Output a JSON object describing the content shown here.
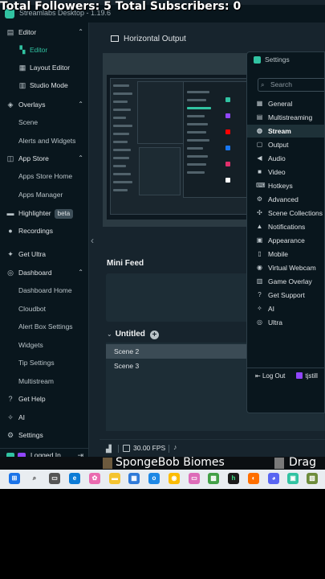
{
  "overlay": {
    "text": "Total Followers: 5  Total Subscribers: 0"
  },
  "window": {
    "title": "Streamlabs Desktop - 1.19.6"
  },
  "sidebar": {
    "items": [
      {
        "label": "Editor",
        "icon": "editor-icon",
        "chevron": "^"
      },
      {
        "label": "Editor",
        "icon": "editor-icon",
        "active": true
      },
      {
        "label": "Layout Editor",
        "icon": "layout-icon"
      },
      {
        "label": "Studio Mode",
        "icon": "studio-mode-icon"
      },
      {
        "label": "Overlays",
        "icon": "overlays-icon",
        "chevron": "^"
      },
      {
        "label": "Scene"
      },
      {
        "label": "Alerts and Widgets"
      },
      {
        "label": "App Store",
        "icon": "app-store-icon",
        "chevron": "^"
      },
      {
        "label": "Apps Store Home"
      },
      {
        "label": "Apps Manager"
      },
      {
        "label": "Highlighter",
        "icon": "highlighter-icon",
        "badge": "beta"
      },
      {
        "label": "Recordings",
        "icon": "recordings-icon"
      },
      {
        "label": "Get Ultra",
        "icon": "ultra-icon"
      },
      {
        "label": "Dashboard",
        "icon": "dashboard-icon",
        "chevron": "^"
      },
      {
        "label": "Dashboard Home"
      },
      {
        "label": "Cloudbot"
      },
      {
        "label": "Alert Box Settings"
      },
      {
        "label": "Widgets"
      },
      {
        "label": "Tip Settings"
      },
      {
        "label": "Multistream"
      },
      {
        "label": "Get Help",
        "icon": "help-icon"
      },
      {
        "label": "AI",
        "icon": "ai-icon"
      },
      {
        "label": "Settings",
        "icon": "gear-icon"
      }
    ],
    "logged_in": "Logged In"
  },
  "main": {
    "output_title": "Horizontal Output",
    "mini_feed_label": "Mini Feed",
    "scenes_header": "Untitled",
    "scenes": [
      "Scene 2",
      "Scene 3"
    ],
    "selected_scene": "Scene 2",
    "fps": "30.00 FPS"
  },
  "settings_panel": {
    "title": "Settings",
    "search_placeholder": "Search",
    "items": [
      {
        "label": "General",
        "icon": "general-icon"
      },
      {
        "label": "Multistreaming",
        "icon": "multistream-icon"
      },
      {
        "label": "Stream",
        "icon": "globe-icon",
        "active": true
      },
      {
        "label": "Output",
        "icon": "output-icon"
      },
      {
        "label": "Audio",
        "icon": "audio-icon"
      },
      {
        "label": "Video",
        "icon": "video-icon"
      },
      {
        "label": "Hotkeys",
        "icon": "keyboard-icon"
      },
      {
        "label": "Advanced",
        "icon": "advanced-icon"
      },
      {
        "label": "Scene Collections",
        "icon": "scene-collections-icon"
      },
      {
        "label": "Notifications",
        "icon": "bell-icon"
      },
      {
        "label": "Appearance",
        "icon": "appearance-icon"
      },
      {
        "label": "Mobile",
        "icon": "mobile-icon"
      },
      {
        "label": "Virtual Webcam",
        "icon": "webcam-icon"
      },
      {
        "label": "Game Overlay",
        "icon": "game-overlay-icon"
      },
      {
        "label": "Get Support",
        "icon": "support-icon"
      },
      {
        "label": "AI",
        "icon": "ai-icon"
      },
      {
        "label": "Ultra",
        "icon": "ultra-icon"
      }
    ],
    "logout_label": "Log Out",
    "username": "tjstill"
  },
  "ticker": {
    "text1": "SpongeBob Biomes",
    "text2": "Drag"
  },
  "colors": {
    "accent": "#31c3a2",
    "sidebar_bg": "#09161d",
    "main_bg": "#17242d",
    "twitch": "#9146ff"
  }
}
